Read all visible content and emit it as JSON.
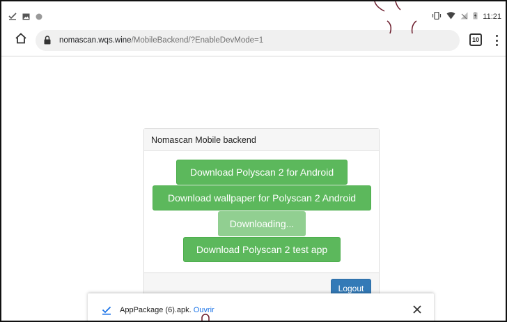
{
  "status_bar": {
    "time": "11:21",
    "left_icons": [
      "download-done-icon",
      "image-icon",
      "dot-icon"
    ],
    "right_icons": [
      "vibrate-icon",
      "wifi-icon",
      "signal-icon",
      "battery-icon"
    ]
  },
  "browser": {
    "url_host": "nomascan.wqs.wine",
    "url_path": "/MobileBackend/?EnableDevMode=1",
    "tab_count": "10"
  },
  "panel": {
    "title": "Nomascan Mobile backend",
    "buttons": [
      {
        "label": "Download Polyscan 2 for Android",
        "state": "normal"
      },
      {
        "label": "Download wallpaper for Polyscan 2 Android",
        "state": "normal"
      },
      {
        "label": "Downloading...",
        "state": "disabled"
      },
      {
        "label": "Download Polyscan 2 test app",
        "state": "normal"
      }
    ],
    "logout_label": "Logout"
  },
  "download_bar": {
    "file_name": "AppPackage (6).apk.",
    "open_label": "Ouvrir"
  },
  "colors": {
    "success": "#5cb85c",
    "success_disabled": "#91cf91",
    "primary": "#337ab7",
    "link": "#1a73e8"
  }
}
